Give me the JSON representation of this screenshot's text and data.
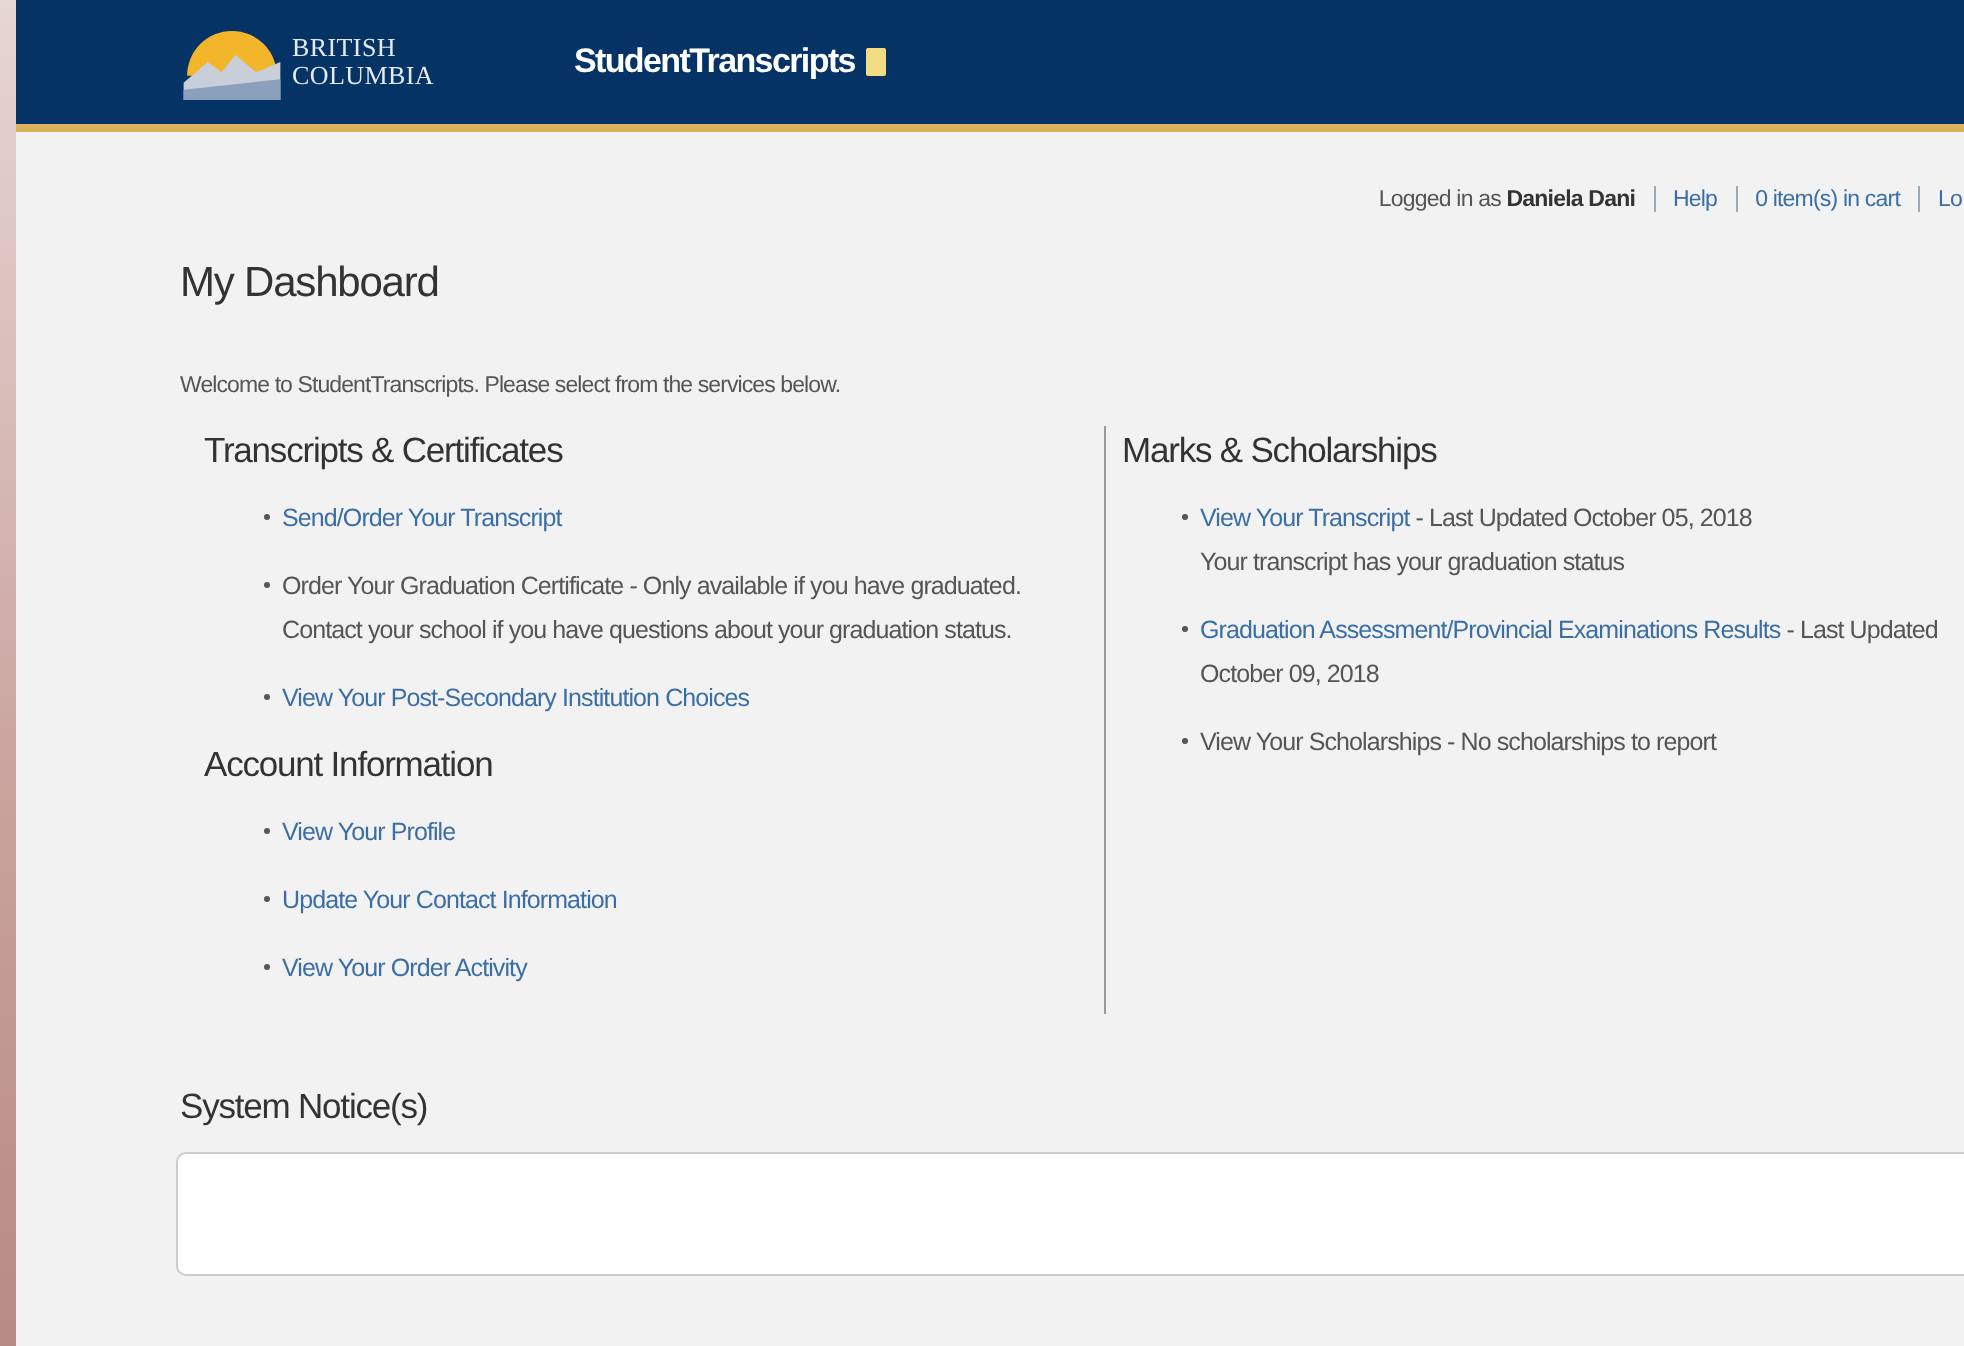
{
  "header": {
    "logo_lines": [
      "BRITISH",
      "COLUMBIA"
    ],
    "app_title": "StudentTranscripts"
  },
  "user_bar": {
    "greeting": "Logged in as **Daniela Dani**",
    "links": [
      "Help",
      "0 item(s) in cart",
      "Lo"
    ]
  },
  "page_title": "My Dashboard",
  "welcome": "Welcome to StudentTranscripts. Please select from the services below.",
  "left_sections": [
    {
      "title": "Transcripts & Certificates",
      "items": [
        {
          "kind": "link",
          "link": "Send/Order Your Transcript"
        },
        {
          "kind": "text",
          "text": "Order Your Graduation Certificate - Only available if you have graduated. Contact your school if you have questions about your graduation status."
        },
        {
          "kind": "link",
          "link": "View Your Post-Secondary Institution Choices"
        }
      ]
    },
    {
      "title": "Account Information",
      "items": [
        {
          "kind": "link",
          "link": "View Your Profile"
        },
        {
          "kind": "link",
          "link": "Update Your Contact Information"
        },
        {
          "kind": "link",
          "link": "View Your Order Activity"
        }
      ]
    }
  ],
  "right_sections": [
    {
      "title": "Marks & Scholarships",
      "items": [
        {
          "kind": "link",
          "link": "View Your Transcript",
          "note": " - Last Updated October 05, 2018",
          "detail": "Your transcript has your graduation status"
        },
        {
          "kind": "link",
          "link": "Graduation Assessment/Provincial Examinations Results",
          "note": " - Last Updated October 09, 2018"
        },
        {
          "kind": "text",
          "text": "View Your Scholarships - No scholarships to report"
        }
      ]
    }
  ],
  "notices": {
    "title": "System Notice(s)"
  }
}
